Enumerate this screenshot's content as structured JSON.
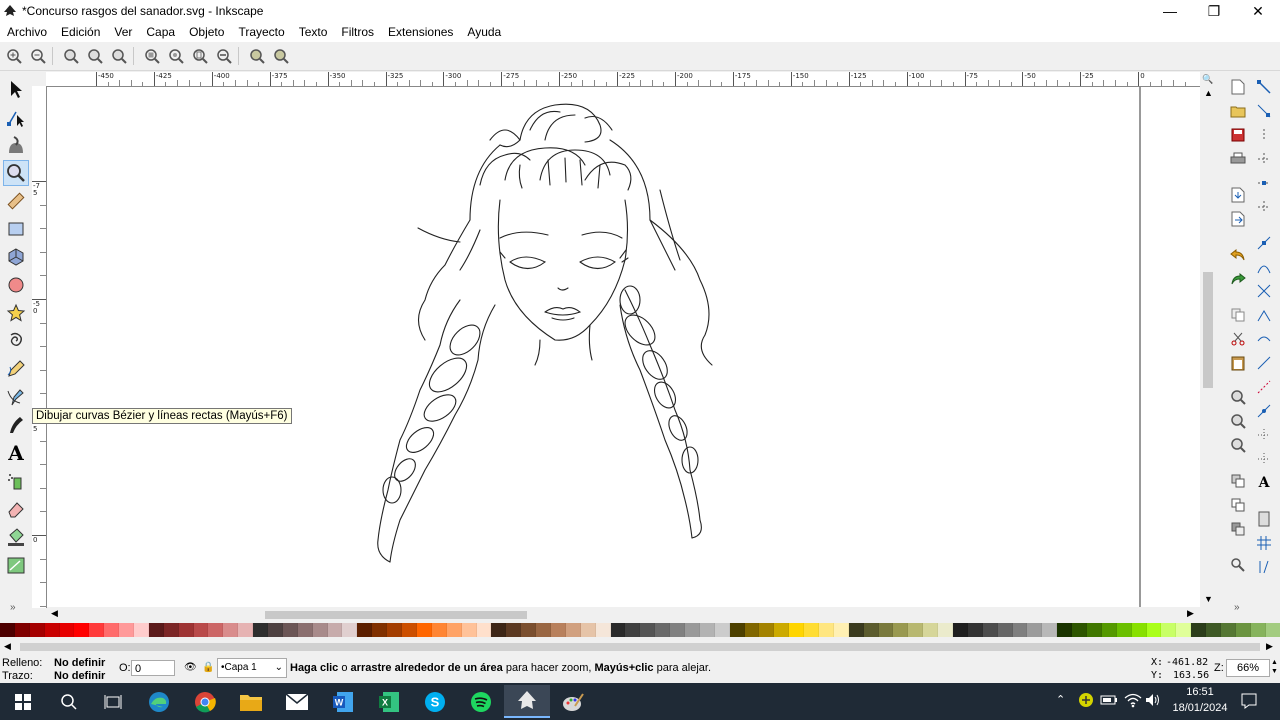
{
  "window": {
    "title": "*Concurso rasgos del sanador.svg - Inkscape",
    "minimize": "—",
    "maximize": "❐",
    "close": "✕"
  },
  "menu": [
    "Archivo",
    "Edición",
    "Ver",
    "Capa",
    "Objeto",
    "Trayecto",
    "Texto",
    "Filtros",
    "Extensiones",
    "Ayuda"
  ],
  "ruler": {
    "h_ticks": [
      "-450",
      "-425",
      "-400",
      "-375",
      "-350",
      "-325",
      "-300",
      "-275",
      "-250",
      "-225",
      "-200",
      "-175",
      "-150",
      "-125",
      "-100",
      "-75",
      "-50",
      "-25",
      "0"
    ],
    "v_ticks": [
      "-75",
      "-50",
      "-25",
      "0"
    ]
  },
  "tooltip": "Dibujar curvas Bézier y líneas rectas (Mayús+F6)",
  "palette_colors": [
    "#4d0000",
    "#800000",
    "#a40000",
    "#c80000",
    "#e60000",
    "#ff0000",
    "#ff3a3a",
    "#ff6b6b",
    "#ff9999",
    "#ffcccc",
    "#5b1a1a",
    "#7c2626",
    "#9e3333",
    "#b94a4a",
    "#cc6666",
    "#d98c8c",
    "#e6b3b3",
    "#2e2e2e",
    "#4d4040",
    "#6b5555",
    "#8a6e6e",
    "#a88a8a",
    "#c7abab",
    "#e0cfcf",
    "#5c1f00",
    "#803000",
    "#a33d00",
    "#cc4f00",
    "#ff6600",
    "#ff8533",
    "#ffa366",
    "#ffc299",
    "#ffe0cc",
    "#3d2616",
    "#5c3a22",
    "#7a4e2e",
    "#996642",
    "#b8805c",
    "#d1a07f",
    "#e6c4a8",
    "#f5e6d9",
    "#2a2a2a",
    "#404040",
    "#555555",
    "#6a6a6a",
    "#808080",
    "#999999",
    "#b3b3b3",
    "#cccccc",
    "#4d4000",
    "#806600",
    "#a38200",
    "#ccaa00",
    "#ffd500",
    "#ffdd33",
    "#ffe680",
    "#fff0b3",
    "#3b3b1f",
    "#5c5c2e",
    "#7a7a3d",
    "#999950",
    "#b8b870",
    "#d6d699",
    "#ebebcc",
    "#1f1f1f",
    "#333333",
    "#4d4d4d",
    "#666666",
    "#7f7f7f",
    "#9b9b9b",
    "#b8b8b8",
    "#1a3300",
    "#2d5500",
    "#407700",
    "#559900",
    "#6bbf00",
    "#88e000",
    "#aaff1a",
    "#c8ff66",
    "#e0ff99",
    "#2b3d1a",
    "#3f5a26",
    "#557733",
    "#6b9440",
    "#86b35c",
    "#a3cc80"
  ],
  "status": {
    "fill_label": "Relleno:",
    "fill_value": "No definir",
    "stroke_label": "Trazo:",
    "stroke_value": "No definir",
    "opacity_label": "O:",
    "opacity_value": "0",
    "layer": "•Capa 1",
    "message_b1": "Haga clic",
    "message_t1": " o ",
    "message_b2": "arrastre alrededor de un área",
    "message_t2": " para hacer zoom, ",
    "message_b3": "Mayús+clic",
    "message_t3": " para alejar.",
    "x_label": "X:",
    "x_value": "-461.82",
    "y_label": "Y:",
    "y_value": "163.56",
    "zoom_label": "Z:",
    "zoom_value": "66%"
  },
  "taskbar": {
    "time": "16:51",
    "date": "18/01/2024"
  }
}
